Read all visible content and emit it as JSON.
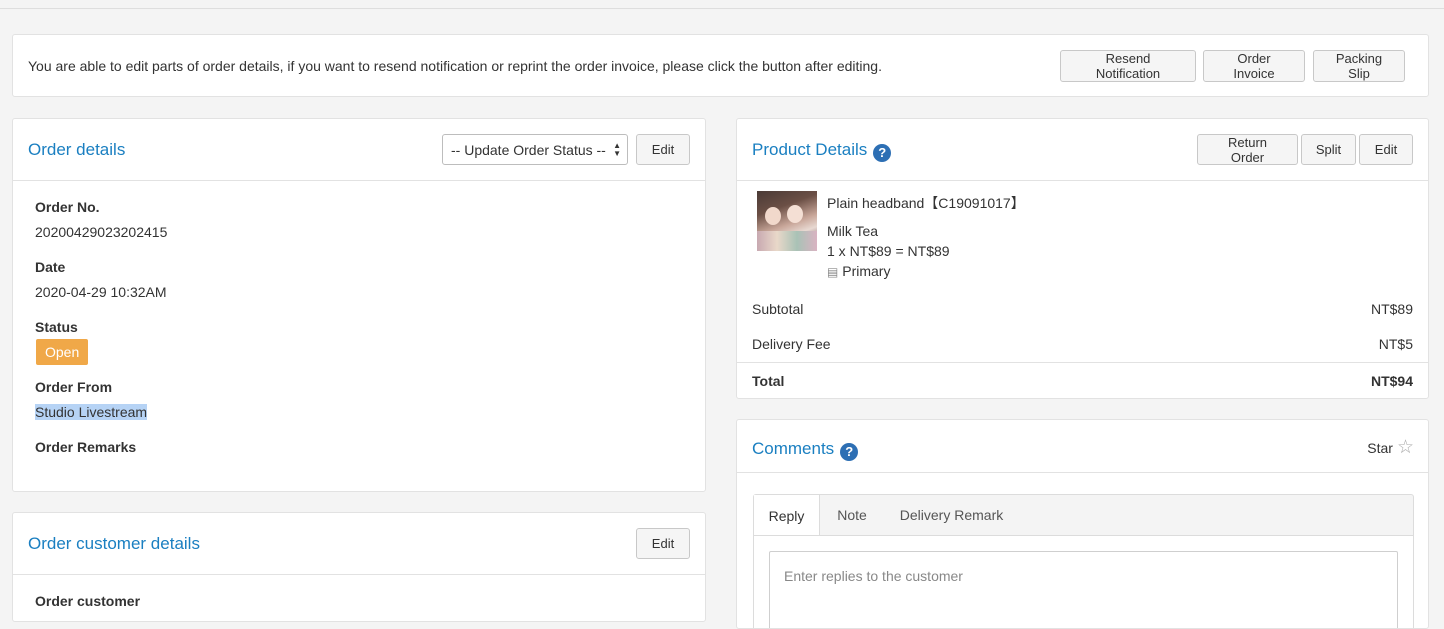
{
  "notice": {
    "text": "You are able to edit parts of order details, if you want to resend notification or reprint the order invoice, please click the button after editing.",
    "buttons": {
      "resend": "Resend Notification",
      "invoice": "Order Invoice",
      "packing": "Packing Slip"
    }
  },
  "order_details": {
    "title": "Order details",
    "status_select": "-- Update Order Status --",
    "edit": "Edit",
    "fields": {
      "order_no_label": "Order No.",
      "order_no": "20200429023202415",
      "date_label": "Date",
      "date": "2020-04-29 10:32AM",
      "status_label": "Status",
      "status": "Open",
      "order_from_label": "Order From",
      "order_from": "Studio Livestream",
      "remarks_label": "Order Remarks"
    }
  },
  "customer_details": {
    "title": "Order customer details",
    "edit": "Edit",
    "customer_label": "Order customer"
  },
  "product_details": {
    "title": "Product Details",
    "help": "?",
    "buttons": {
      "return": "Return Order",
      "split": "Split",
      "edit": "Edit"
    },
    "item": {
      "name": "Plain headband【C19091017】",
      "variant": "Milk Tea",
      "price_line": "1 x NT$89 = NT$89",
      "warehouse": "Primary"
    },
    "summary": {
      "subtotal_label": "Subtotal",
      "subtotal": "NT$89",
      "delivery_label": "Delivery Fee",
      "delivery": "NT$5",
      "total_label": "Total",
      "total": "NT$94"
    }
  },
  "comments": {
    "title": "Comments",
    "help": "?",
    "star_label": "Star",
    "tabs": [
      "Reply",
      "Note",
      "Delivery Remark"
    ],
    "reply_placeholder": "Enter replies to the customer"
  },
  "colors": {
    "link_blue": "#1a7fc1",
    "status_open": "#f0a848",
    "help_icon": "#2d6fb4"
  }
}
